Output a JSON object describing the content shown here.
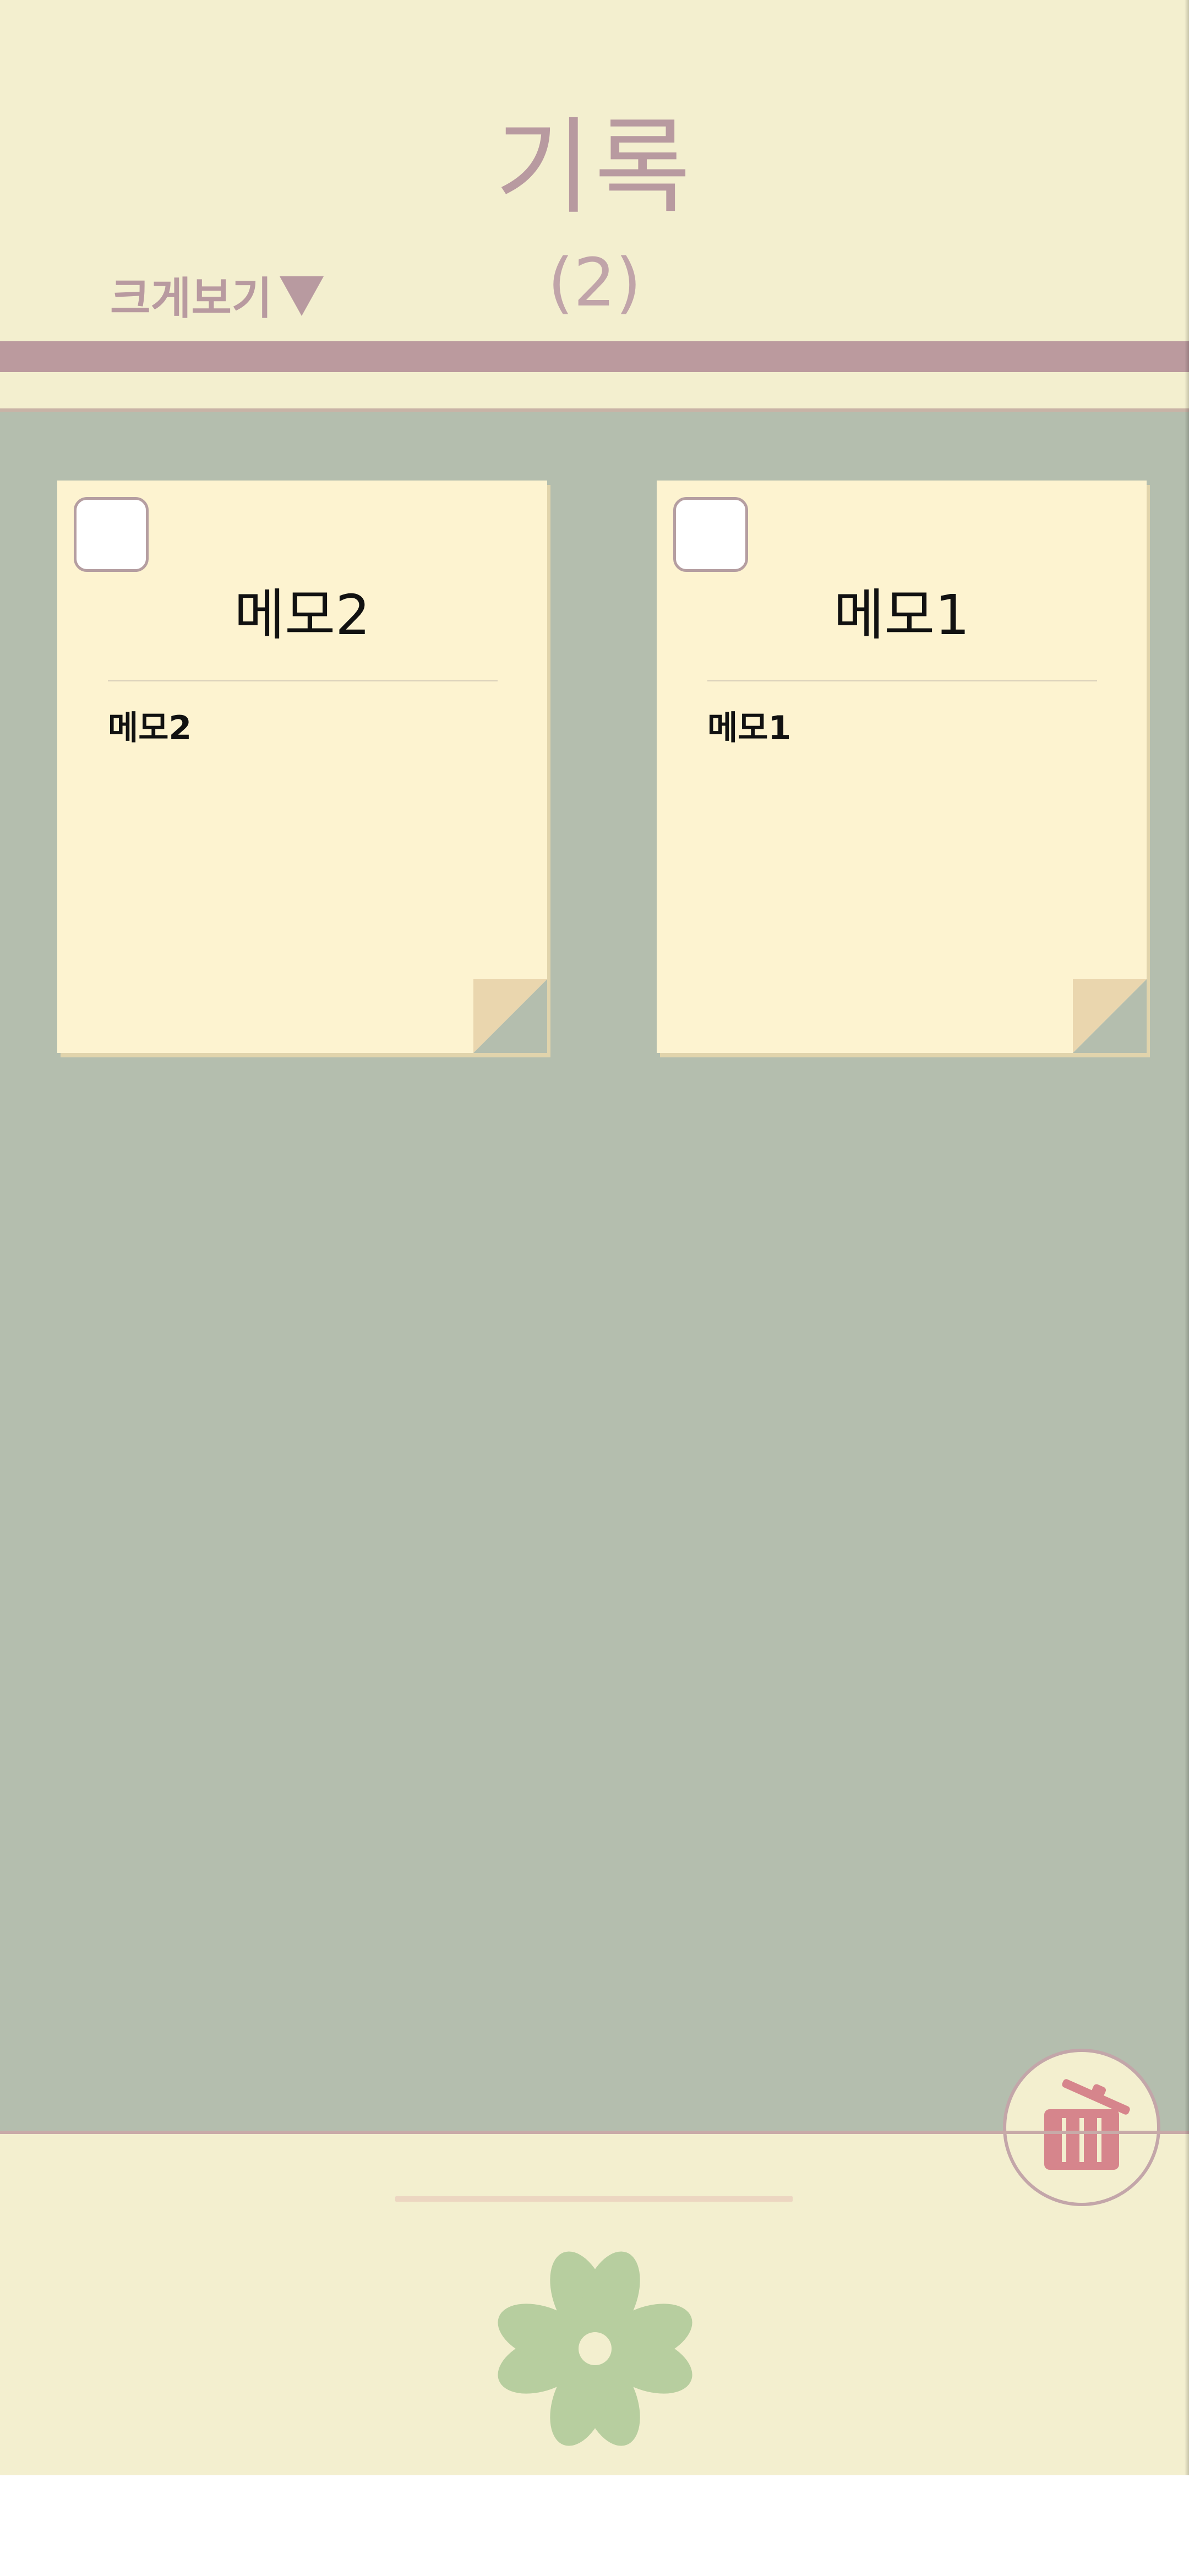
{
  "header": {
    "title": "기록",
    "count": "(2)",
    "view_toggle_label": "크게보기"
  },
  "memos": [
    {
      "title": "메모2",
      "body": "메모2",
      "checked": false
    },
    {
      "title": "메모1",
      "body": "메모1",
      "checked": false
    }
  ],
  "actions": {
    "delete_icon": "trash-icon"
  },
  "footer": {
    "logo_icon": "clover-icon"
  },
  "colors": {
    "background": "#f3efcf",
    "content_background": "#b4beae",
    "accent": "#bb9a9e",
    "memo_paper": "#fdf3d0",
    "trash": "#d6858c",
    "clover": "#b7ce9f"
  }
}
